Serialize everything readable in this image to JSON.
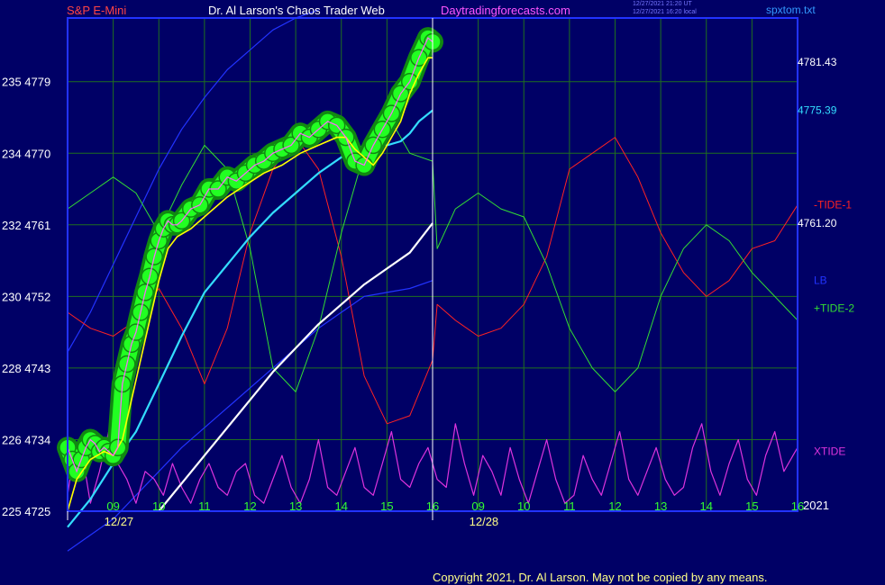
{
  "header": {
    "instrument": "S&P E-Mini",
    "author": "Dr. Al Larson's Chaos Trader Web",
    "site": "Daytradingforecasts.com",
    "stamp_line1": "12/27/2021 21:20 UT",
    "stamp_line2": "12/27/2021 16:20 local",
    "file": "spxtom.txt"
  },
  "footer": {
    "copyright": "Copyright 2021, Dr. Al Larson. May not be copied by any means."
  },
  "colors": {
    "background": "#000066",
    "grid": "#1f6f1f",
    "frame": "#2233ff",
    "left_axis": "#ffffff",
    "hour_labels": "#33ff33",
    "date_labels": "#ffff88",
    "price": "#ff66ff",
    "glow": "#22ff22",
    "glow_dark": "#118811",
    "yellow_avg": "#ffff00",
    "cyan_avg": "#33ddff",
    "white_avg": "#ffffff",
    "tide1": "#ff2222",
    "tide2": "#33dd33",
    "lb": "#2233ff",
    "xtide": "#dd33dd",
    "header_instrument": "#ff4444",
    "header_author": "#ffffff",
    "header_site": "#ff55ff",
    "header_file": "#3399ff"
  },
  "chart_data": {
    "type": "line",
    "title": "S&P E-Mini",
    "ylim": [
      4725,
      4787
    ],
    "y_ticks": [
      {
        "label": "225 4725",
        "value": 4725
      },
      {
        "label": "226 4734",
        "value": 4734
      },
      {
        "label": "228 4743",
        "value": 4743
      },
      {
        "label": "230 4752",
        "value": 4752
      },
      {
        "label": "232 4761",
        "value": 4761
      },
      {
        "label": "234 4770",
        "value": 4770
      },
      {
        "label": "235 4779",
        "value": 4779
      }
    ],
    "x_hour_labels": [
      "09",
      "10",
      "11",
      "12",
      "13",
      "14",
      "15",
      "16",
      "09",
      "10",
      "11",
      "12",
      "13",
      "14",
      "15",
      "16"
    ],
    "x_hour_positions": [
      0.5,
      1.5,
      2.5,
      3.5,
      4.5,
      5.5,
      6.5,
      7.5,
      8.5,
      9.5,
      10.5,
      11.5,
      12.5,
      13.5,
      14.5,
      15.5
    ],
    "x_date_labels": [
      {
        "label": "12/27",
        "at": 0.5
      },
      {
        "label": "12/28",
        "at": 8.5
      }
    ],
    "year_label": "2021",
    "now_x": 7.5,
    "x_range": [
      -0.5,
      15.5
    ],
    "right_labels": [
      {
        "label": "4781.43",
        "series": "price",
        "value": 4781.43,
        "color": "#ffffff"
      },
      {
        "label": "4775.39",
        "series": "cyan_avg",
        "value": 4775.39,
        "color": "#33ddff"
      },
      {
        "label": "4761.20",
        "series": "white_avg",
        "value": 4761.2,
        "color": "#ffffff"
      },
      {
        "label": "-TIDE-1",
        "series": "tide1",
        "value": 4763.5,
        "color": "#ff2222"
      },
      {
        "label": "LB",
        "series": "lb",
        "value": 4754,
        "color": "#2233ff"
      },
      {
        "label": "+TIDE-2",
        "series": "tide2",
        "value": 4750.5,
        "color": "#33dd33"
      },
      {
        "label": "XTIDE",
        "series": "xtide",
        "value": 4732.5,
        "color": "#dd33dd"
      }
    ],
    "series": [
      {
        "key": "price",
        "x": [
          -0.5,
          -0.4,
          -0.3,
          -0.2,
          -0.1,
          0.0,
          0.1,
          0.2,
          0.3,
          0.4,
          0.5,
          0.6,
          0.7,
          0.8,
          0.9,
          1.0,
          1.1,
          1.2,
          1.3,
          1.4,
          1.5,
          1.6,
          1.7,
          1.8,
          1.9,
          2.0,
          2.2,
          2.4,
          2.6,
          2.8,
          3.0,
          3.2,
          3.4,
          3.6,
          3.8,
          4.0,
          4.2,
          4.4,
          4.6,
          4.8,
          5.0,
          5.2,
          5.4,
          5.6,
          5.8,
          6.0,
          6.2,
          6.4,
          6.6,
          6.8,
          7.0,
          7.2,
          7.4,
          7.5
        ],
        "values": [
          4733,
          4731.5,
          4730,
          4731.5,
          4733,
          4734,
          4733.5,
          4732.5,
          4733,
          4732.5,
          4732,
          4733,
          4741,
          4743.5,
          4746,
          4747.5,
          4750,
          4752.5,
          4754.5,
          4757,
          4759,
          4760.5,
          4761.5,
          4761,
          4761,
          4761.5,
          4763,
          4763.5,
          4765.5,
          4765.5,
          4767,
          4766.5,
          4767.5,
          4768.5,
          4769,
          4770,
          4770.5,
          4771,
          4772.5,
          4772,
          4773,
          4774,
          4773.5,
          4772,
          4769,
          4768.5,
          4771,
          4773,
          4775,
          4777.5,
          4779,
          4782,
          4784.5,
          4784
        ]
      },
      {
        "key": "yellow_avg",
        "x": [
          -0.5,
          -0.3,
          0.0,
          0.3,
          0.5,
          0.7,
          0.9,
          1.1,
          1.3,
          1.5,
          1.7,
          1.9,
          2.2,
          2.6,
          3.0,
          3.4,
          3.8,
          4.2,
          4.6,
          5.0,
          5.4,
          5.6,
          5.8,
          6.0,
          6.2,
          6.4,
          6.6,
          6.8,
          7.0,
          7.2,
          7.4,
          7.5
        ],
        "values": [
          4725,
          4729,
          4731.5,
          4732.5,
          4732,
          4734,
          4739,
          4744,
          4749,
          4754,
          4758,
          4759.5,
          4760.5,
          4762.5,
          4764.5,
          4766,
          4767.5,
          4768.5,
          4770,
          4771,
          4772,
          4772,
          4770.5,
          4769.5,
          4768.5,
          4770,
          4772,
          4774,
          4777.5,
          4780,
          4782,
          4782
        ]
      },
      {
        "key": "cyan_avg",
        "x": [
          -0.5,
          0.0,
          0.5,
          1.0,
          1.5,
          2.0,
          2.5,
          3.0,
          3.5,
          4.0,
          4.5,
          5.0,
          5.5,
          6.0,
          6.2,
          6.5,
          6.8,
          7.0,
          7.2,
          7.5
        ],
        "values": [
          4723,
          4726.5,
          4731,
          4735,
          4741,
          4747,
          4752.5,
          4756,
          4759.5,
          4762.5,
          4765,
          4767.5,
          4769.5,
          4771,
          4771.3,
          4771,
          4771.5,
          4772.5,
          4774,
          4775.39
        ]
      },
      {
        "key": "white_avg",
        "x": [
          1.5,
          2.0,
          2.5,
          3.0,
          3.5,
          4.0,
          4.5,
          5.0,
          5.5,
          6.0,
          6.5,
          7.0,
          7.5
        ],
        "values": [
          4725,
          4728.5,
          4732,
          4735.5,
          4739,
          4742.5,
          4745.5,
          4748.5,
          4751,
          4753.5,
          4755.5,
          4757.5,
          4761.2
        ]
      },
      {
        "key": "lb",
        "x": [
          -0.5,
          0.0,
          0.5,
          1.0,
          1.5,
          2.0,
          2.5,
          3.0,
          3.5,
          4.0,
          4.5,
          5.0,
          5.5,
          6.0,
          6.5,
          7.0,
          7.5
        ],
        "values": [
          4720,
          4722,
          4724,
          4727,
          4730,
          4733,
          4735.5,
          4738,
          4740.5,
          4743,
          4745.5,
          4748,
          4750,
          4752,
          4752.5,
          4753,
          4754
        ]
      },
      {
        "key": "upper_band",
        "x": [
          -0.5,
          0.0,
          0.5,
          1.0,
          1.5,
          2.0,
          2.5,
          3.0,
          3.5,
          4.0,
          4.5,
          5.0
        ],
        "values": [
          4745,
          4750,
          4756,
          4762,
          4768,
          4773,
          4777,
          4780.5,
          4783,
          4785.5,
          4787,
          4788
        ]
      },
      {
        "key": "tide1",
        "x": [
          -0.5,
          0.0,
          0.5,
          1.0,
          1.5,
          2.0,
          2.5,
          3.0,
          3.5,
          4.0,
          4.5,
          5.0,
          5.5,
          6.0,
          6.5,
          7.0,
          7.5,
          7.6,
          8.0,
          8.5,
          9.0,
          9.5,
          10.0,
          10.5,
          11.0,
          11.5,
          12.0,
          12.5,
          13.0,
          13.5,
          14.0,
          14.5,
          15.0,
          15.5
        ],
        "values": [
          4750,
          4748,
          4747,
          4749,
          4753,
          4748,
          4741,
          4748,
          4760,
          4768,
          4772,
          4768,
          4757,
          4742,
          4736,
          4737,
          4744,
          4751,
          4749,
          4747,
          4748,
          4751,
          4757,
          4768,
          4770,
          4772,
          4767,
          4760,
          4755,
          4752,
          4754,
          4758,
          4759,
          4763.5
        ]
      },
      {
        "key": "tide2",
        "x": [
          -0.5,
          0.0,
          0.5,
          1.0,
          1.5,
          2.0,
          2.5,
          3.0,
          3.5,
          4.0,
          4.5,
          5.0,
          5.5,
          6.0,
          6.5,
          7.0,
          7.5,
          7.6,
          8.0,
          8.5,
          9.0,
          9.5,
          10.0,
          10.5,
          11.0,
          11.5,
          12.0,
          12.5,
          13.0,
          13.5,
          14.0,
          14.5,
          15.0,
          15.5
        ],
        "values": [
          4763,
          4765,
          4767,
          4765,
          4760,
          4766,
          4771,
          4768,
          4758,
          4743,
          4740,
          4748,
          4760,
          4770,
          4775,
          4770,
          4769,
          4758,
          4763,
          4765,
          4763,
          4762,
          4756,
          4748,
          4743,
          4740,
          4743,
          4752,
          4758,
          4761,
          4759,
          4755,
          4752,
          4749
        ]
      },
      {
        "key": "xtide",
        "x": [
          -0.5,
          -0.4,
          -0.2,
          0.0,
          0.2,
          0.4,
          0.6,
          0.8,
          1.0,
          1.2,
          1.4,
          1.6,
          1.8,
          2.0,
          2.2,
          2.4,
          2.6,
          2.8,
          3.0,
          3.2,
          3.4,
          3.6,
          3.8,
          4.0,
          4.2,
          4.4,
          4.6,
          4.8,
          5.0,
          5.2,
          5.4,
          5.6,
          5.8,
          6.0,
          6.2,
          6.4,
          6.6,
          6.8,
          7.0,
          7.2,
          7.4,
          7.6,
          7.8,
          8.0,
          8.2,
          8.4,
          8.6,
          8.8,
          9.0,
          9.2,
          9.4,
          9.6,
          9.8,
          10.0,
          10.2,
          10.4,
          10.6,
          10.8,
          11.0,
          11.2,
          11.4,
          11.6,
          11.8,
          12.0,
          12.2,
          12.4,
          12.6,
          12.8,
          13.0,
          13.2,
          13.4,
          13.6,
          13.8,
          14.0,
          14.2,
          14.4,
          14.6,
          14.8,
          15.0,
          15.2,
          15.4,
          15.5
        ],
        "values": [
          4727,
          4731,
          4733,
          4726,
          4730,
          4735,
          4731,
          4729,
          4726,
          4730,
          4729,
          4727,
          4731,
          4728,
          4726,
          4729,
          4731,
          4728,
          4727,
          4730,
          4731,
          4727,
          4726,
          4729,
          4732,
          4728,
          4726,
          4729,
          4734,
          4728,
          4727,
          4730,
          4733,
          4728,
          4727,
          4731,
          4735,
          4729,
          4728,
          4731,
          4733,
          4729,
          4728,
          4736,
          4731,
          4727,
          4732,
          4730,
          4727,
          4733,
          4729,
          4726,
          4730,
          4734,
          4729,
          4726,
          4727,
          4732,
          4729,
          4727,
          4731,
          4735,
          4729,
          4727,
          4730,
          4733,
          4729,
          4727,
          4728,
          4733,
          4736,
          4730,
          4727,
          4731,
          4734,
          4729,
          4727,
          4732,
          4735,
          4730,
          4732,
          4733
        ]
      }
    ]
  }
}
